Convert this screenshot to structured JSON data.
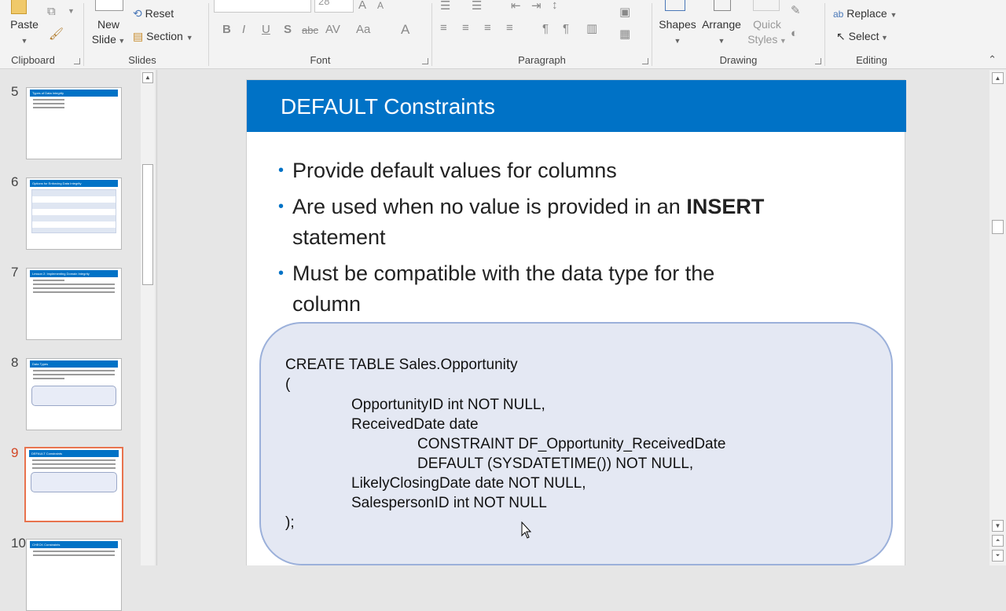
{
  "ribbon": {
    "clipboard": {
      "label": "Clipboard",
      "paste": "Paste"
    },
    "slides": {
      "label": "Slides",
      "new_slide_line1": "New",
      "new_slide_line2": "Slide",
      "reset": "Reset",
      "section": "Section"
    },
    "font": {
      "label": "Font",
      "font_size": "28",
      "buttons": [
        "B",
        "I",
        "U",
        "S",
        "abc",
        "AV",
        "Aa",
        "A"
      ]
    },
    "paragraph": {
      "label": "Paragraph"
    },
    "drawing": {
      "label": "Drawing",
      "shapes": "Shapes",
      "arrange": "Arrange",
      "quick_styles_line1": "Quick",
      "quick_styles_line2": "Styles"
    },
    "editing": {
      "label": "Editing",
      "replace": "Replace",
      "select": "Select"
    }
  },
  "thumbnails": [
    {
      "number": "5",
      "title": "Types of Data Integrity"
    },
    {
      "number": "6",
      "title": "Options for Enforcing Data Integrity"
    },
    {
      "number": "7",
      "title": "Lesson 2: Implementing Domain Integrity"
    },
    {
      "number": "8",
      "title": "Data Types"
    },
    {
      "number": "9",
      "title": "DEFAULT Constraints",
      "selected": true
    },
    {
      "number": "10",
      "title": "CHECK Constraints"
    }
  ],
  "slide": {
    "title": "DEFAULT Constraints",
    "bullets": [
      {
        "text": "Provide default values for columns"
      },
      {
        "text_before": "Are used when no value is provided in an ",
        "bold": "INSERT",
        "text_after": "statement"
      },
      {
        "line1": "Must be compatible with the data type for the",
        "line2": "column"
      }
    ],
    "code": [
      "CREATE TABLE Sales.Opportunity",
      "(",
      "OpportunityID int NOT NULL,",
      "ReceivedDate date",
      "CONSTRAINT DF_Opportunity_ReceivedDate",
      "DEFAULT (SYSDATETIME()) NOT NULL,",
      "LikelyClosingDate date NOT NULL,",
      "SalespersonID int NOT NULL",
      ");"
    ]
  },
  "colors": {
    "title_bar": "#0072c6",
    "selected_thumb_border": "#e8734e",
    "code_box_fill": "#e4e8f3",
    "code_box_border": "#9bb0da"
  }
}
